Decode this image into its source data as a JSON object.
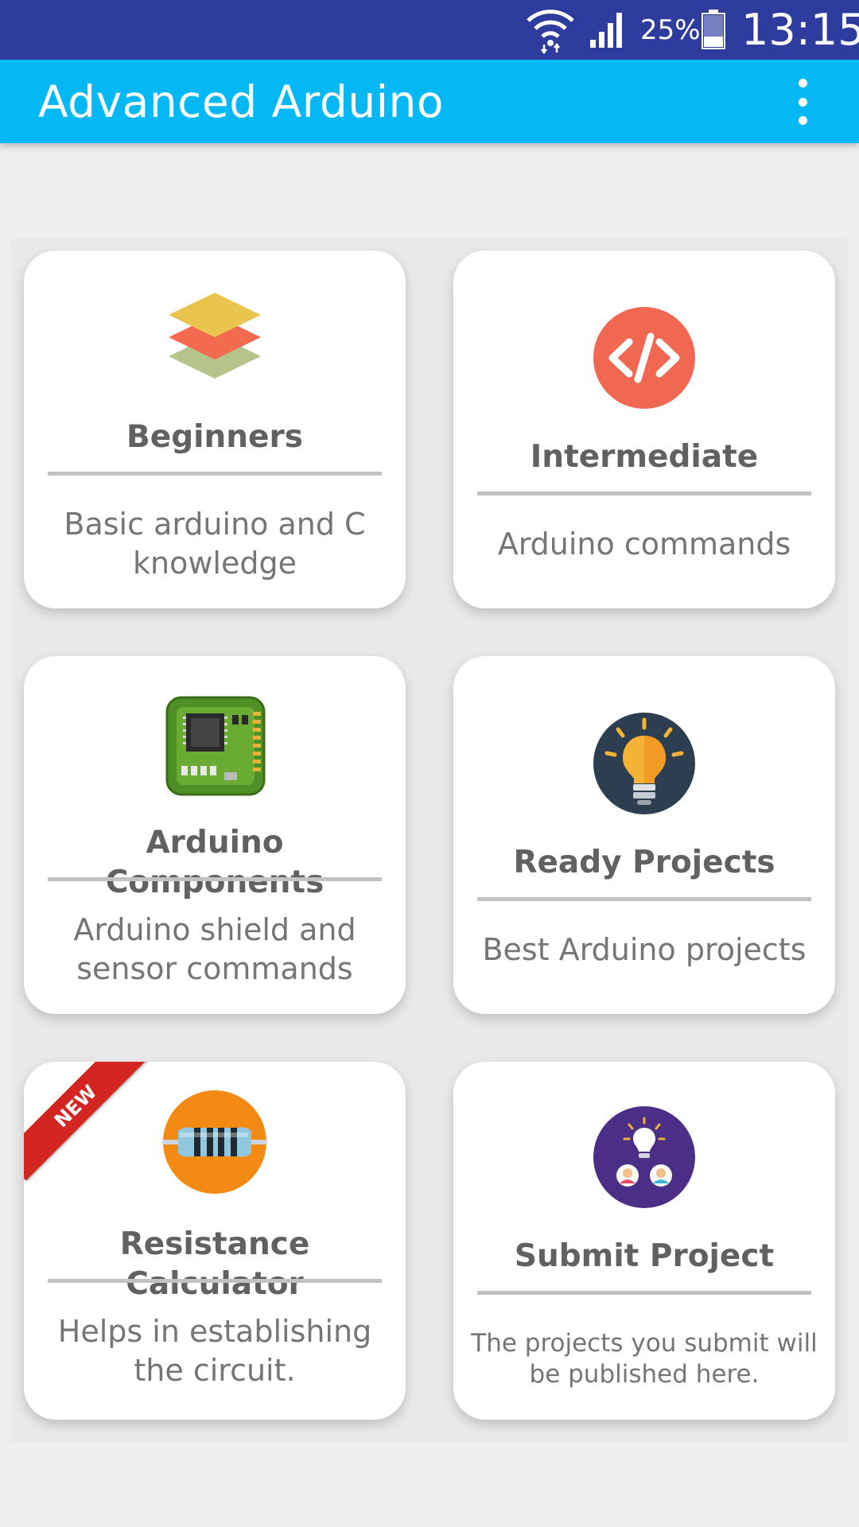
{
  "status_bar": {
    "battery_percent": "25%",
    "time": "13:15",
    "icons": [
      "wifi-icon",
      "signal-icon",
      "battery-icon"
    ]
  },
  "app_bar": {
    "title": "Advanced Arduino",
    "menu_icon": "more-vert-icon"
  },
  "cards": [
    {
      "title": "Beginners",
      "description": "Basic arduino and C knowledge",
      "icon": "layers-icon"
    },
    {
      "title": "Intermediate",
      "description": "Arduino commands",
      "icon": "code-icon"
    },
    {
      "title": "Arduino Components",
      "description": "Arduino shield and sensor commands",
      "icon": "circuit-board-icon"
    },
    {
      "title": "Ready Projects",
      "description": "Best Arduino projects",
      "icon": "lightbulb-icon"
    },
    {
      "title": "Resistance Calculator",
      "description": "Helps in establishing the circuit.",
      "icon": "resistor-icon",
      "badge": "NEW"
    },
    {
      "title": "Submit Project",
      "description": "The projects you submit will be published here.",
      "icon": "idea-people-icon"
    }
  ],
  "colors": {
    "status_bar": "#2e3c9e",
    "app_bar": "#03b8f4",
    "background": "#efefef",
    "card": "#ffffff",
    "title_text": "#616161",
    "description_text": "#757575",
    "badge": "#d32521"
  }
}
